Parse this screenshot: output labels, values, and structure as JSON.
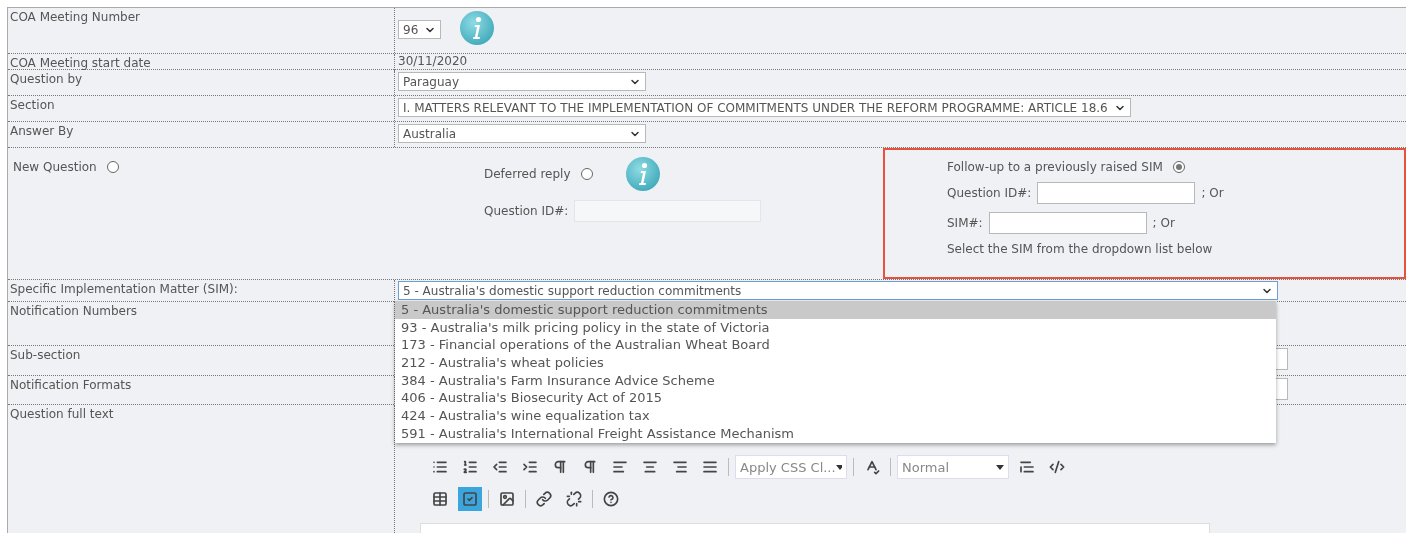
{
  "fields": [
    {
      "kind": "select-info",
      "label": "COA Meeting Number",
      "value": "96"
    },
    {
      "kind": "text",
      "label": "COA Meeting start date",
      "value": "30/11/2020"
    },
    {
      "kind": "select",
      "label": "Question by",
      "value": "Paraguay"
    },
    {
      "kind": "select-wide",
      "label": "Section",
      "value": "I. MATTERS RELEVANT TO THE IMPLEMENTATION OF COMMITMENTS UNDER THE REFORM PROGRAMME: ARTICLE 18.6"
    },
    {
      "kind": "select",
      "label": "Answer By",
      "value": "Australia"
    }
  ],
  "question_type": {
    "new_question": {
      "label": "New Question",
      "selected": false
    },
    "deferred_reply": {
      "label": "Deferred reply",
      "selected": false,
      "id_label": "Question ID#:",
      "id_disabled": true
    },
    "follow_up": {
      "label": "Follow-up to a previously raised SIM",
      "selected": true,
      "highlighted": true,
      "id_label": "Question ID#:",
      "id_suffix": "; Or",
      "sim_label": "SIM#:",
      "sim_suffix": "; Or",
      "hint": "Select the SIM from the dropdown list below"
    }
  },
  "sim": {
    "label": "Specific Implementation Matter (SIM):",
    "value": "5 - Australia's domestic support reduction commitments",
    "expanded": true,
    "options": [
      {
        "label": "5 - Australia's domestic support reduction commitments",
        "selected": true
      },
      {
        "label": "93 - Australia's milk pricing policy in the state of Victoria",
        "selected": false
      },
      {
        "label": "173 - Financial operations of the Australian Wheat Board",
        "selected": false
      },
      {
        "label": "212 - Australia's wheat policies",
        "selected": false
      },
      {
        "label": "384 - Australia's Farm Insurance Advice Scheme",
        "selected": false
      },
      {
        "label": "406 - Australia's Biosecurity Act of 2015",
        "selected": false
      },
      {
        "label": "424 - Australia's wine equalization tax",
        "selected": false
      },
      {
        "label": "591 - Australia's International Freight Assistance Mechanism",
        "selected": false
      }
    ]
  },
  "lower_rows": [
    {
      "label": "Notification Numbers"
    },
    {
      "label": "Sub-section"
    },
    {
      "label": "Notification Formats"
    }
  ],
  "full_text": {
    "label": "Question full text",
    "toolbar_rows": [
      [
        {
          "kind": "bulleted-list",
          "pressed": false
        },
        {
          "kind": "numbered-list",
          "pressed": false
        },
        {
          "kind": "outdent",
          "pressed": false
        },
        {
          "kind": "indent",
          "pressed": false
        },
        {
          "kind": "ltr",
          "pressed": false
        },
        {
          "kind": "rtl",
          "pressed": false
        },
        {
          "kind": "align-left",
          "pressed": false
        },
        {
          "kind": "align-center",
          "pressed": false
        },
        {
          "kind": "align-right",
          "pressed": false
        },
        {
          "kind": "justify",
          "pressed": false
        },
        {
          "kind": "dropdown",
          "value": "Apply CSS Cl..."
        },
        {
          "kind": "spellcheck",
          "pressed": false
        },
        {
          "kind": "dropdown",
          "value": "Normal"
        },
        {
          "kind": "paragraph",
          "pressed": false
        },
        {
          "kind": "code-edit",
          "pressed": false
        }
      ],
      [
        {
          "kind": "table",
          "pressed": false
        },
        {
          "kind": "template",
          "pressed": true
        },
        {
          "kind": "image",
          "pressed": false
        },
        {
          "kind": "link",
          "pressed": false
        },
        {
          "kind": "unlink",
          "pressed": false
        },
        {
          "kind": "help",
          "pressed": false
        }
      ]
    ]
  }
}
